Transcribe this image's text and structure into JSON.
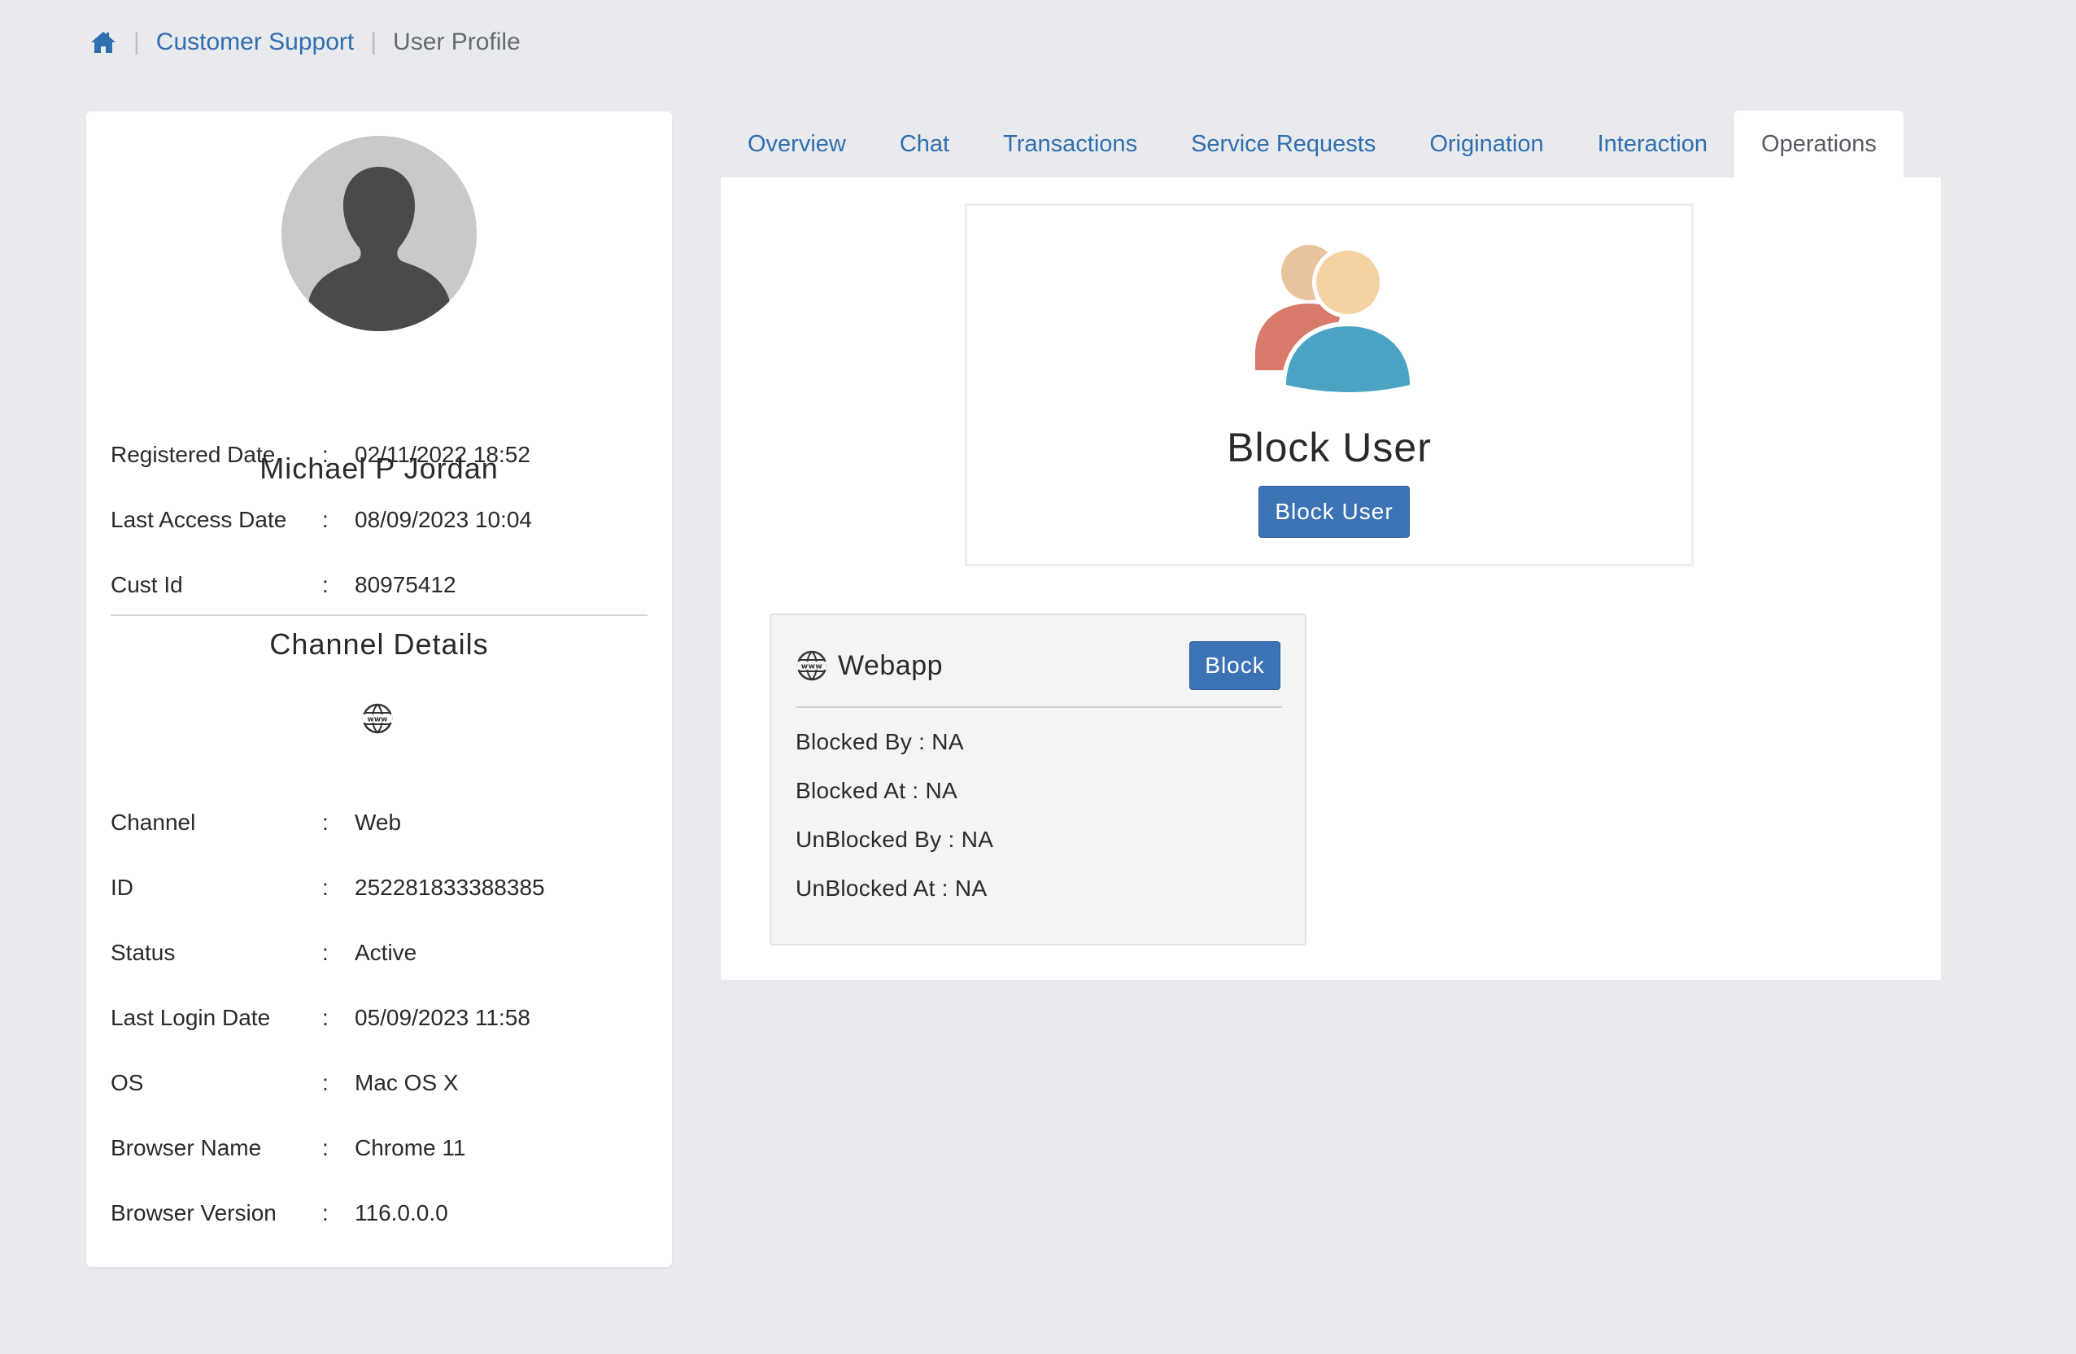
{
  "breadcrumb": {
    "home_icon": "home-icon",
    "items": [
      "Customer Support",
      "User Profile"
    ]
  },
  "profile": {
    "name": "Michael P Jordan",
    "fields": [
      {
        "label": "Registered Date",
        "value": "02/11/2022 18:52"
      },
      {
        "label": "Last Access Date",
        "value": "08/09/2023 10:04"
      },
      {
        "label": "Cust Id",
        "value": "80975412"
      }
    ],
    "channel_title": "Channel Details",
    "channel_icon": "www-globe-icon",
    "channel_fields": [
      {
        "label": "Channel",
        "value": "Web"
      },
      {
        "label": "ID",
        "value": "252281833388385"
      },
      {
        "label": "Status",
        "value": "Active"
      },
      {
        "label": "Last Login Date",
        "value": "05/09/2023 11:58"
      },
      {
        "label": "OS",
        "value": "Mac OS X"
      },
      {
        "label": "Browser Name",
        "value": "Chrome 11"
      },
      {
        "label": "Browser Version",
        "value": "116.0.0.0"
      }
    ],
    "colon": ":"
  },
  "tabs": [
    {
      "label": "Overview",
      "active": false
    },
    {
      "label": "Chat",
      "active": false
    },
    {
      "label": "Transactions",
      "active": false
    },
    {
      "label": "Service Requests",
      "active": false
    },
    {
      "label": "Origination",
      "active": false
    },
    {
      "label": "Interaction",
      "active": false
    },
    {
      "label": "Operations",
      "active": true
    }
  ],
  "operations": {
    "block_user": {
      "icon": "users-icon",
      "title": "Block User",
      "button_label": "Block User"
    },
    "webapp": {
      "icon": "www-globe-icon",
      "title": "Webapp",
      "button_label": "Block",
      "lines": [
        "Blocked By : NA",
        "Blocked At : NA",
        "UnBlocked By : NA",
        "UnBlocked At : NA"
      ]
    }
  },
  "colors": {
    "link": "#2f6eaf",
    "primary_button": "#3c73b5",
    "background": "#e9eaee"
  }
}
